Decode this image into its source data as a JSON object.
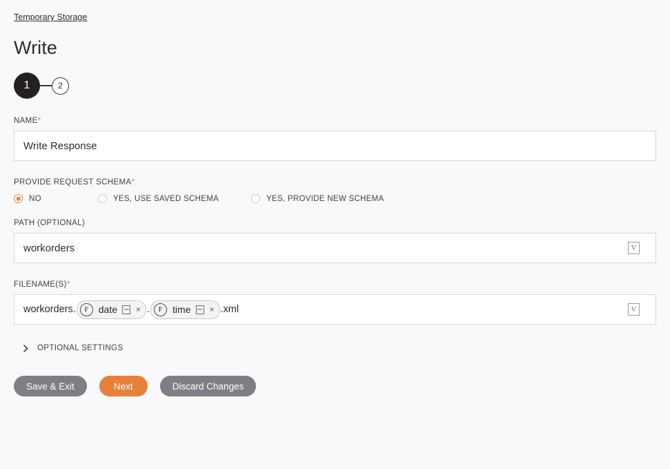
{
  "breadcrumb": {
    "label": "Temporary Storage"
  },
  "header": {
    "title": "Write"
  },
  "stepper": {
    "steps": [
      {
        "number": "1",
        "state": "active"
      },
      {
        "number": "2",
        "state": "inactive"
      }
    ]
  },
  "form": {
    "name_field": {
      "label": "NAME",
      "required_marker": "*",
      "value": "Write Response"
    },
    "schema_field": {
      "label": "PROVIDE REQUEST SCHEMA",
      "required_marker": "*",
      "options": [
        {
          "label": "NO",
          "selected": true
        },
        {
          "label": "YES, USE SAVED SCHEMA",
          "selected": false
        },
        {
          "label": "YES, PROVIDE NEW SCHEMA",
          "selected": false
        }
      ]
    },
    "path_field": {
      "label": "PATH (OPTIONAL)",
      "value": "workorders",
      "dropdown_glyph": "V"
    },
    "filename_field": {
      "label": "FILENAME(S)",
      "required_marker": "*",
      "prefix": "workorders.",
      "separator": ".",
      "suffix": ".xml",
      "dropdown_glyph": "V",
      "chips": [
        {
          "icon": "F",
          "label": "date",
          "close": "×"
        },
        {
          "icon": "F",
          "label": "time",
          "close": "×"
        }
      ]
    },
    "optional_settings": {
      "label": "OPTIONAL SETTINGS",
      "expanded": false
    }
  },
  "actions": {
    "save_exit": "Save & Exit",
    "next": "Next",
    "discard": "Discard Changes"
  },
  "colors": {
    "accent": "#e8803a",
    "required": "#ee7f40",
    "step_active": "#241f21",
    "button_gray": "#7e7e84",
    "background": "#f9f9fb"
  }
}
